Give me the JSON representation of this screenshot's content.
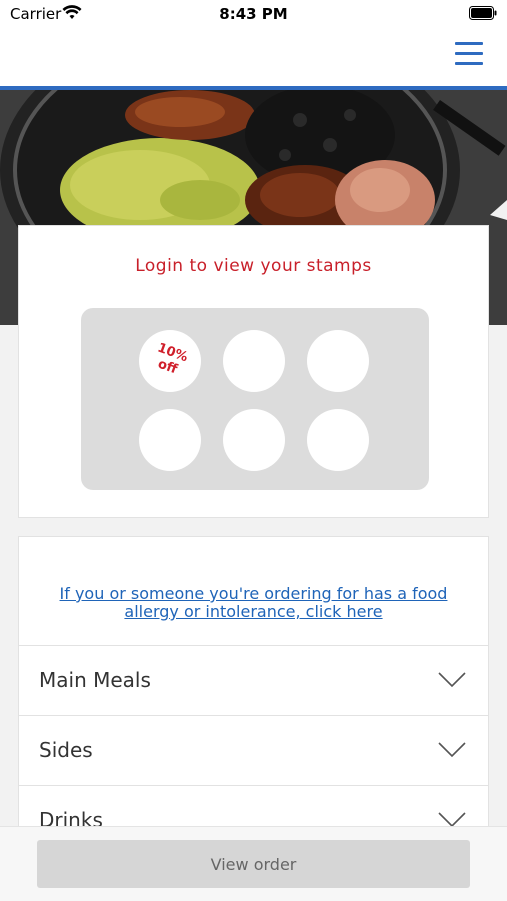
{
  "status_bar": {
    "carrier": "Carrier",
    "time": "8:43 PM"
  },
  "nav": {
    "menu_icon": "hamburger-menu-icon",
    "accent_color": "#2e6bc0"
  },
  "hero": {
    "image": "food-plate-photo"
  },
  "stamps": {
    "title": "Login to view your stamps",
    "reward_label": "10%\noff",
    "reward_color": "#d01f2b",
    "stamp_count": 6
  },
  "allergy": {
    "link_text": "If you or someone you're ordering for has a food allergy or intolerance, click here"
  },
  "categories": [
    {
      "label": "Main Meals"
    },
    {
      "label": "Sides"
    },
    {
      "label": "Drinks"
    }
  ],
  "footer": {
    "view_order_label": "View order"
  }
}
